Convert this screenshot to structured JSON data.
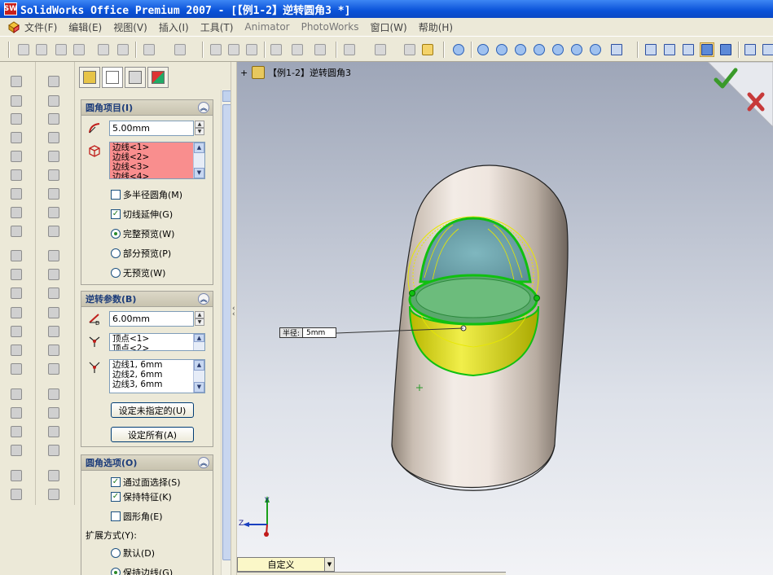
{
  "window": {
    "title": "SolidWorks Office Premium 2007 - [【例1-2】逆转圆角3 *]",
    "app_icon": "SW"
  },
  "menu": {
    "items": [
      {
        "label": "文件(F)"
      },
      {
        "label": "编辑(E)"
      },
      {
        "label": "视图(V)"
      },
      {
        "label": "插入(I)"
      },
      {
        "label": "工具(T)"
      },
      {
        "label": "Animator"
      },
      {
        "label": "PhotoWorks"
      },
      {
        "label": "窗口(W)"
      },
      {
        "label": "帮助(H)"
      }
    ]
  },
  "tree": {
    "expand": "+",
    "root_label": "【例1-2】逆转圆角3"
  },
  "fillet_items": {
    "title": "圆角项目(I)",
    "radius_value": "5.00mm",
    "edges": [
      "边线<1>",
      "边线<2>",
      "边线<3>",
      "边线<4>"
    ],
    "multi_radius": "多半径圆角(M)",
    "tangent_prop": "切线延伸(G)",
    "full_preview": "完整预览(W)",
    "partial_preview": "部分预览(P)",
    "no_preview": "无预览(W)"
  },
  "setback": {
    "title": "逆转参数(B)",
    "distance_value": "6.00mm",
    "vertices": [
      "顶点<1>",
      "顶点<2>"
    ],
    "edges": [
      "边线1, 6mm",
      "边线2, 6mm",
      "边线3, 6mm"
    ],
    "set_unassigned_btn": "设定未指定的(U)",
    "set_all_btn": "设定所有(A)"
  },
  "fillet_options": {
    "title": "圆角选项(O)",
    "select_through_faces": "通过面选择(S)",
    "keep_features": "保持特征(K)",
    "round_corners": "圆形角(E)",
    "overflow_label": "扩展方式(Y):",
    "default": "默认(D)",
    "keep_edge": "保持边线(G)"
  },
  "callout": {
    "label": "半径:",
    "value": "5mm"
  },
  "axes": {
    "y": "Y",
    "z": "Z"
  },
  "view_orientation": "自定义",
  "colors": {
    "accept": "#3a9a2a",
    "cancel": "#c73a3a",
    "edge_highlight": "#22cc22",
    "preview": "#f0f000",
    "pink_list": "#f98e8e"
  },
  "icons": {
    "accept": "check-icon",
    "cancel": "close-icon"
  }
}
